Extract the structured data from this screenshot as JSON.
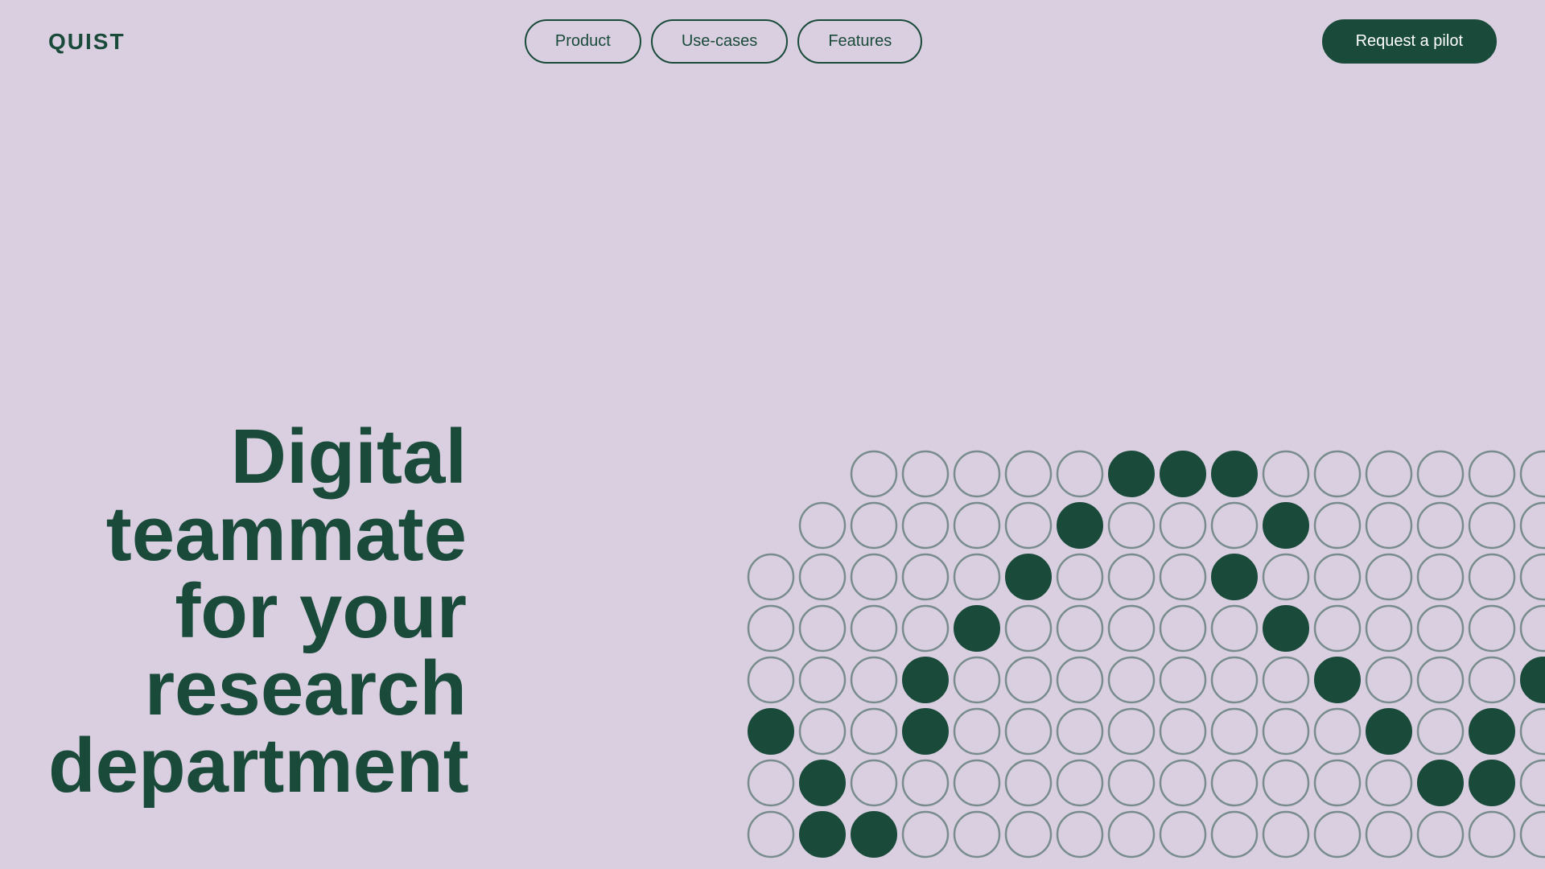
{
  "brand": {
    "logo": "QUIST"
  },
  "nav": {
    "items": [
      {
        "label": "Product",
        "id": "product"
      },
      {
        "label": "Use-cases",
        "id": "use-cases"
      },
      {
        "label": "Features",
        "id": "features"
      }
    ],
    "cta": "Request a pilot"
  },
  "hero": {
    "line1": "Digital",
    "line2": "teammate",
    "line3": "for your",
    "line4": "research",
    "line5": "department"
  },
  "colors": {
    "bg": "#d9cfe0",
    "dark": "#1a4a3a",
    "white": "#ffffff",
    "dotEmpty": "#c4b8cf",
    "dotFilled": "#1a4a3a"
  }
}
